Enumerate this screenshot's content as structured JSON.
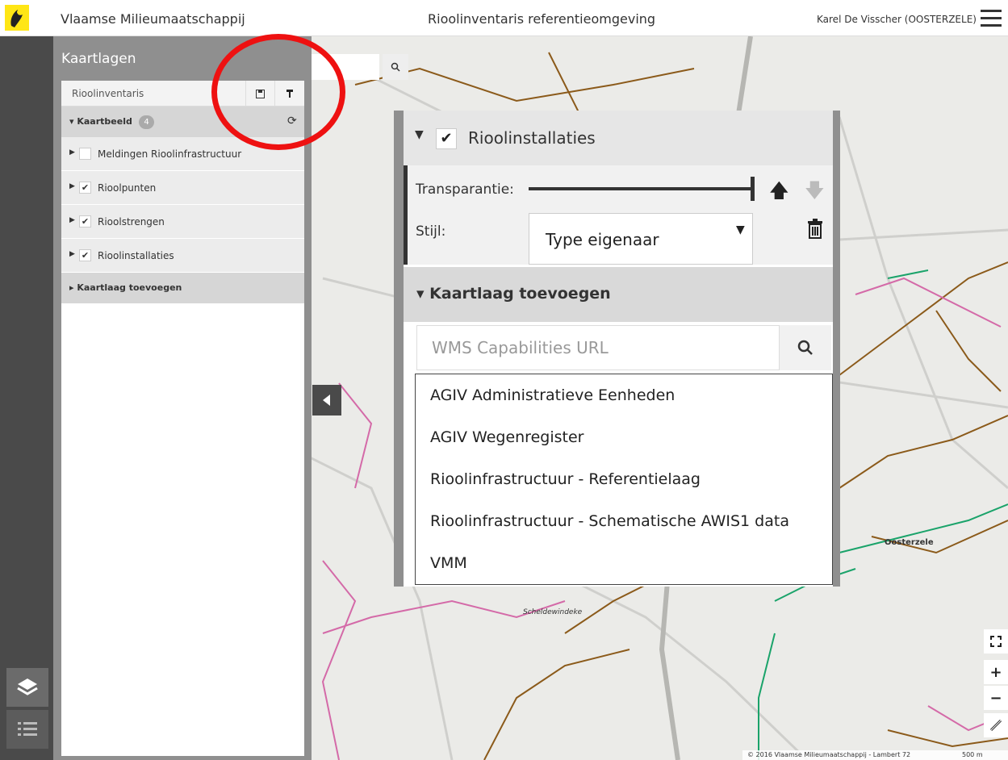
{
  "header": {
    "app_title": "Vlaamse Milieumaatschappij",
    "env_title": "Rioolinventaris referentieomgeving",
    "user": "Karel De Visscher (OOSTERZELE)"
  },
  "panel": {
    "title": "Kaartlagen",
    "workspace": "Rioolinventaris",
    "kaartbeeld_label": "Kaartbeeld",
    "kaartbeeld_count": "4",
    "layers": [
      {
        "label": "Meldingen Rioolinfrastructuur",
        "checked": false
      },
      {
        "label": "Rioolpunten",
        "checked": true
      },
      {
        "label": "Rioolstrengen",
        "checked": true
      },
      {
        "label": "Rioolinstallaties",
        "checked": true
      }
    ],
    "add_label": "Kaartlaag toevoegen"
  },
  "popup": {
    "layer_title": "Rioolinstallaties",
    "transparency_label": "Transparantie:",
    "transparency_value": 1.0,
    "style_label": "Stijl:",
    "style_value": "Type eigenaar",
    "add_label": "Kaartlaag toevoegen",
    "url_placeholder": "WMS Capabilities URL",
    "services": [
      "AGIV Administratieve Eenheden",
      "AGIV Wegenregister",
      "Rioolinfrastructuur - Referentielaag",
      "Rioolinfrastructuur - Schematische AWIS1 data",
      "VMM"
    ]
  },
  "map": {
    "place_labels": [
      "Oosterzele",
      "Scheldewindeke"
    ],
    "attribution": "© 2016 Vlaamse Milieumaatschappij - Lambert 72",
    "scale": "500 m"
  },
  "colors": {
    "accent": "#ee1111",
    "sewer_brown": "#8b5a1a",
    "sewer_pink": "#d46aa8",
    "sewer_green": "#1aa36a"
  }
}
